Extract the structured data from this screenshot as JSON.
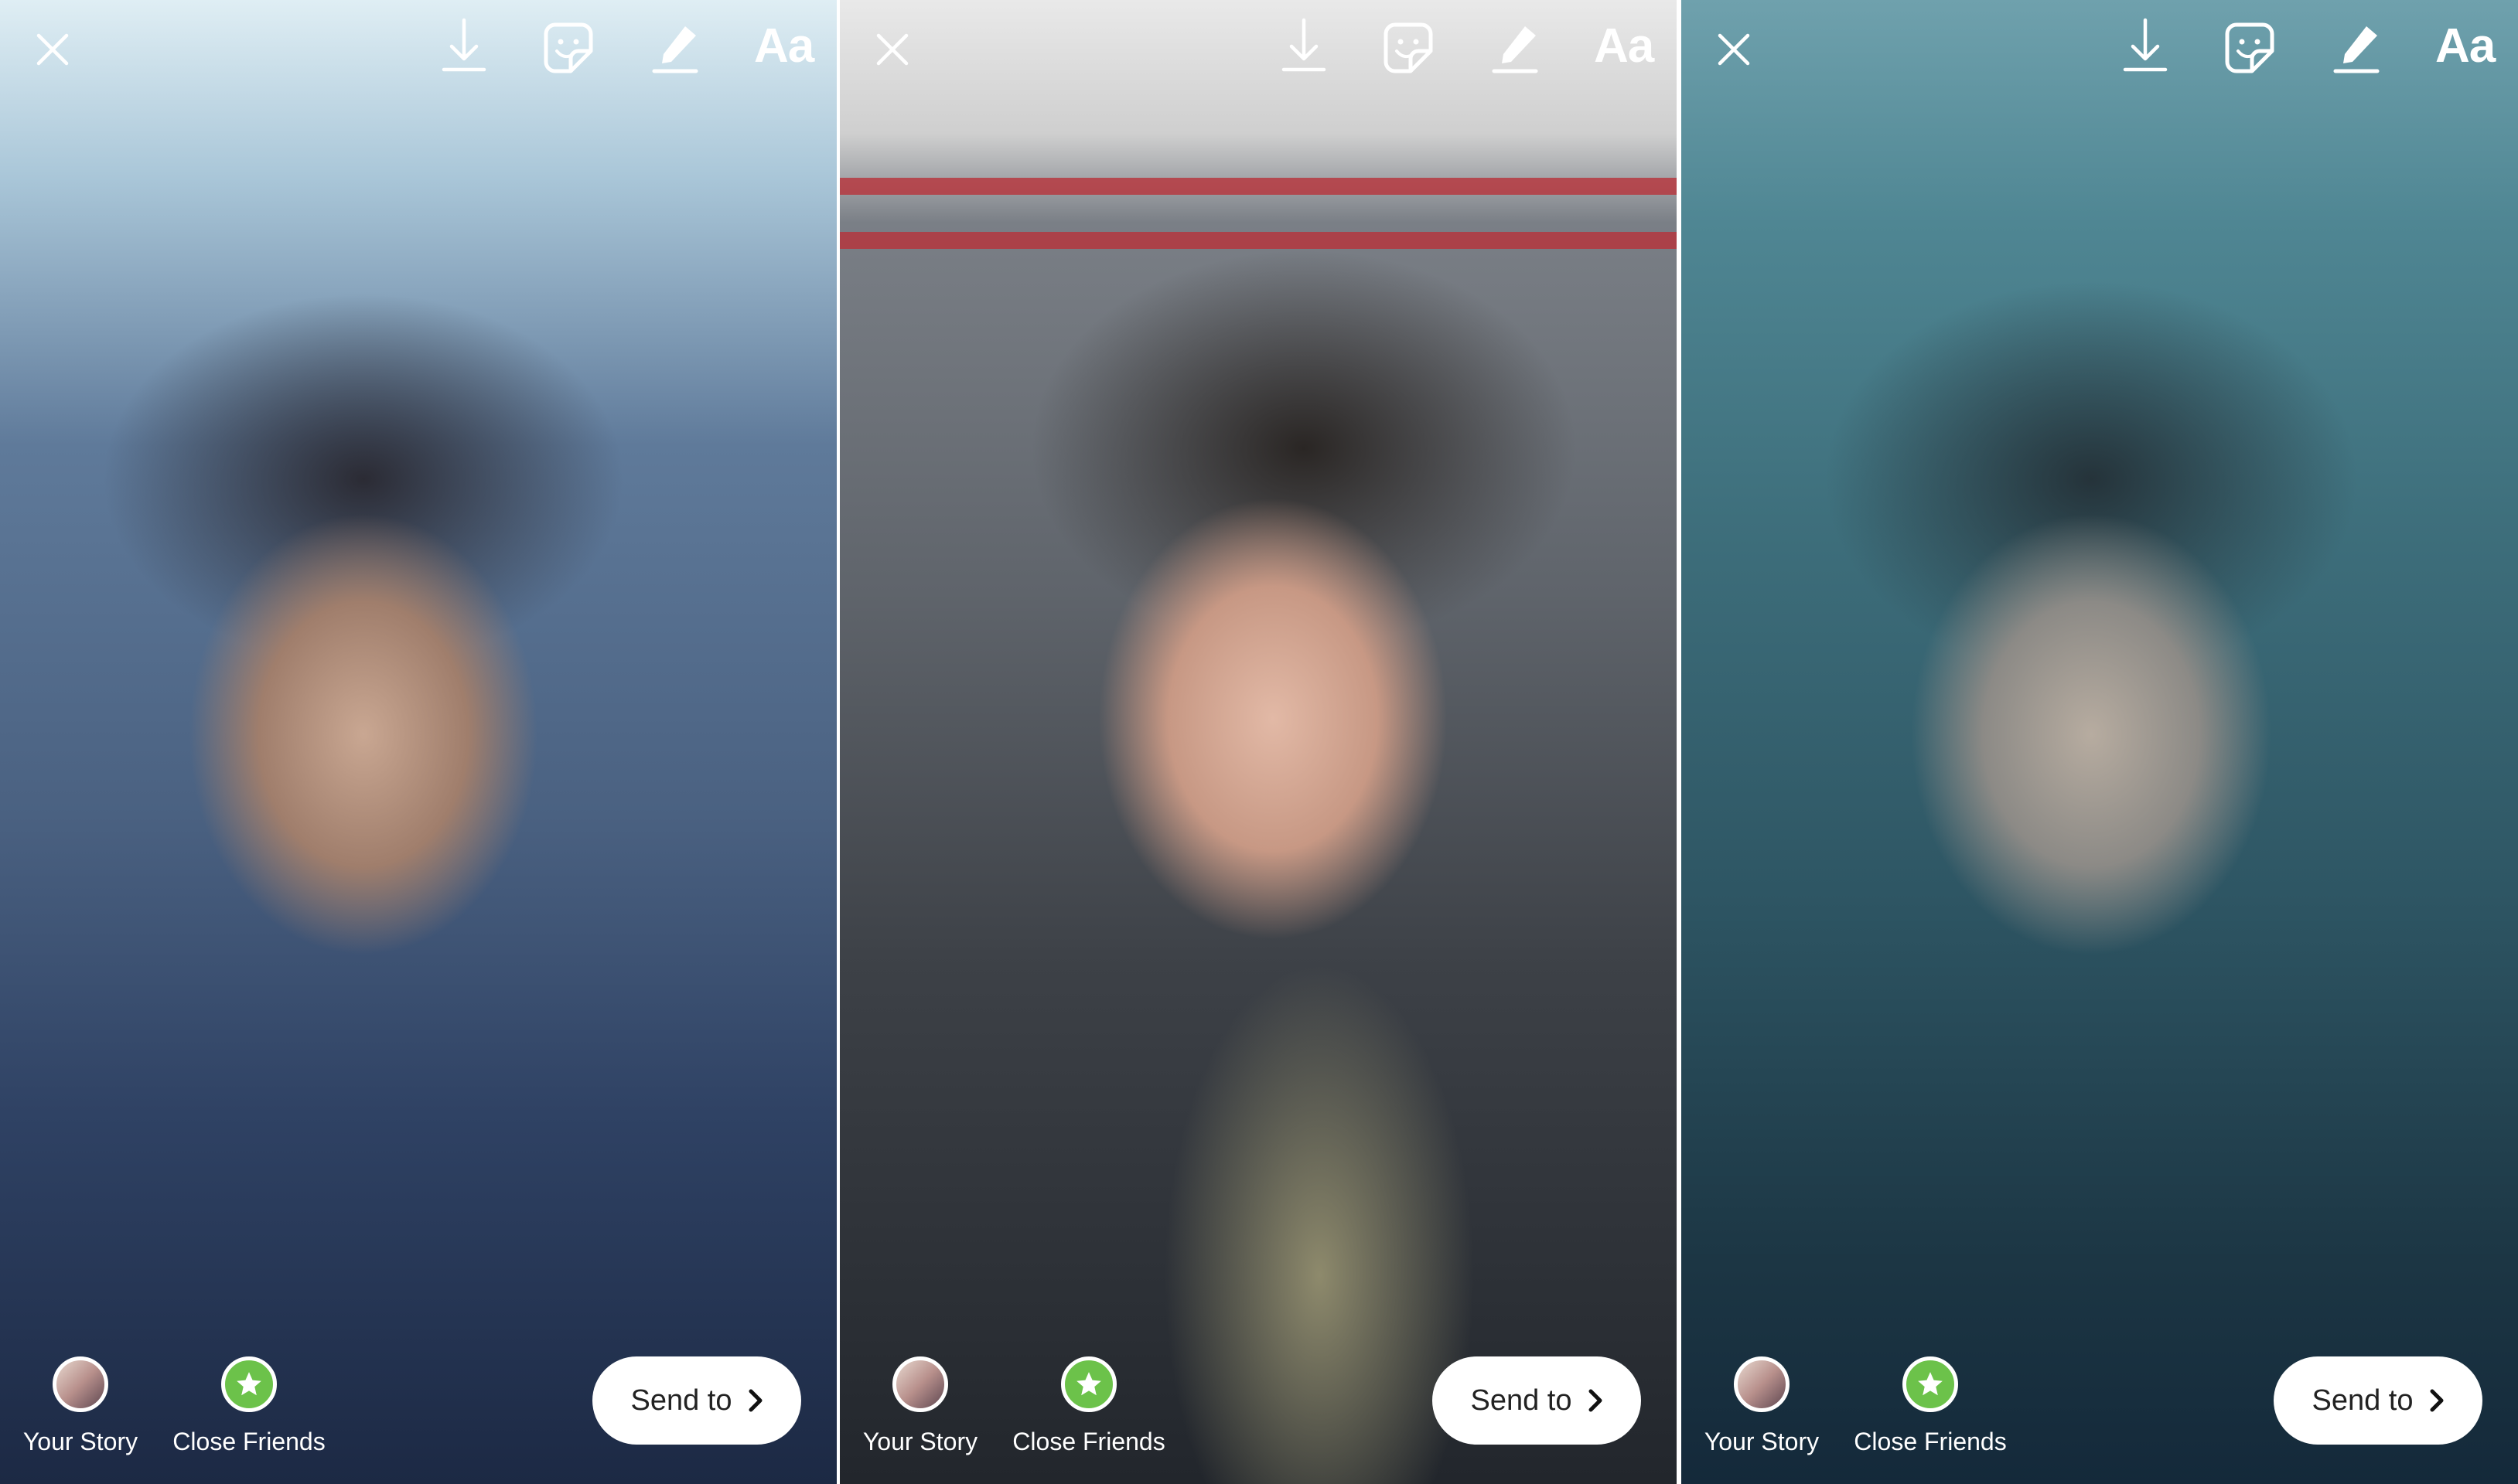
{
  "screens": [
    {
      "toolbar": {
        "close": "close-icon",
        "download": "download-icon",
        "sticker": "sticker-icon",
        "draw": "pen-icon",
        "text": "Aa"
      },
      "share": {
        "your_story": "Your Story",
        "close_friends": "Close Friends",
        "send_to": "Send to"
      },
      "filter": "frost"
    },
    {
      "toolbar": {
        "close": "close-icon",
        "download": "download-icon",
        "sticker": "sticker-icon",
        "draw": "pen-icon",
        "text": "Aa"
      },
      "share": {
        "your_story": "Your Story",
        "close_friends": "Close Friends",
        "send_to": "Send to"
      },
      "filter": "none"
    },
    {
      "toolbar": {
        "close": "close-icon",
        "download": "download-icon",
        "sticker": "sticker-icon",
        "draw": "pen-icon",
        "text": "Aa"
      },
      "share": {
        "your_story": "Your Story",
        "close_friends": "Close Friends",
        "send_to": "Send to"
      },
      "filter": "underwater"
    }
  ],
  "colors": {
    "close_friends_green": "#6cc24a",
    "button_bg": "#ffffff",
    "icon": "#ffffff"
  }
}
